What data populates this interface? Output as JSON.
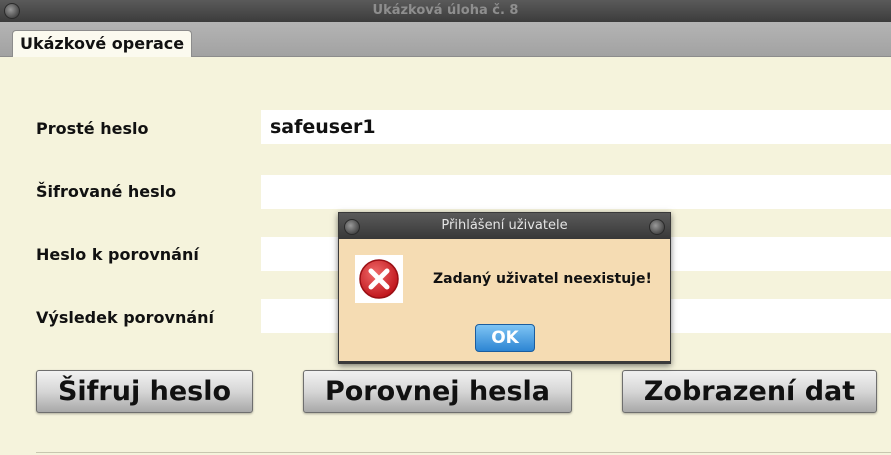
{
  "window": {
    "title": "Ukázková úloha č. 8"
  },
  "tabs": [
    {
      "label": "Ukázkové operace"
    }
  ],
  "form": {
    "plain_password": {
      "label": "Prosté heslo",
      "value": "safeuser1"
    },
    "encrypted_password": {
      "label": "Šifrované heslo",
      "value": ""
    },
    "compare_password": {
      "label": "Heslo k porovnání",
      "value": ""
    },
    "compare_result": {
      "label": "Výsledek porovnání",
      "value": ""
    }
  },
  "buttons": {
    "encrypt": "Šifruj heslo",
    "compare": "Porovnej hesla",
    "show_data": "Zobrazení dat"
  },
  "dialog": {
    "title": "Přihlášení uživatele",
    "message": "Zadaný uživatel neexistuje!",
    "ok_label": "OK",
    "icon": "error-icon"
  },
  "colors": {
    "background": "#f5f3dc",
    "dialog_background": "#f5dcb3",
    "ok_button": "#2d85d3",
    "error_red": "#d8232a"
  }
}
